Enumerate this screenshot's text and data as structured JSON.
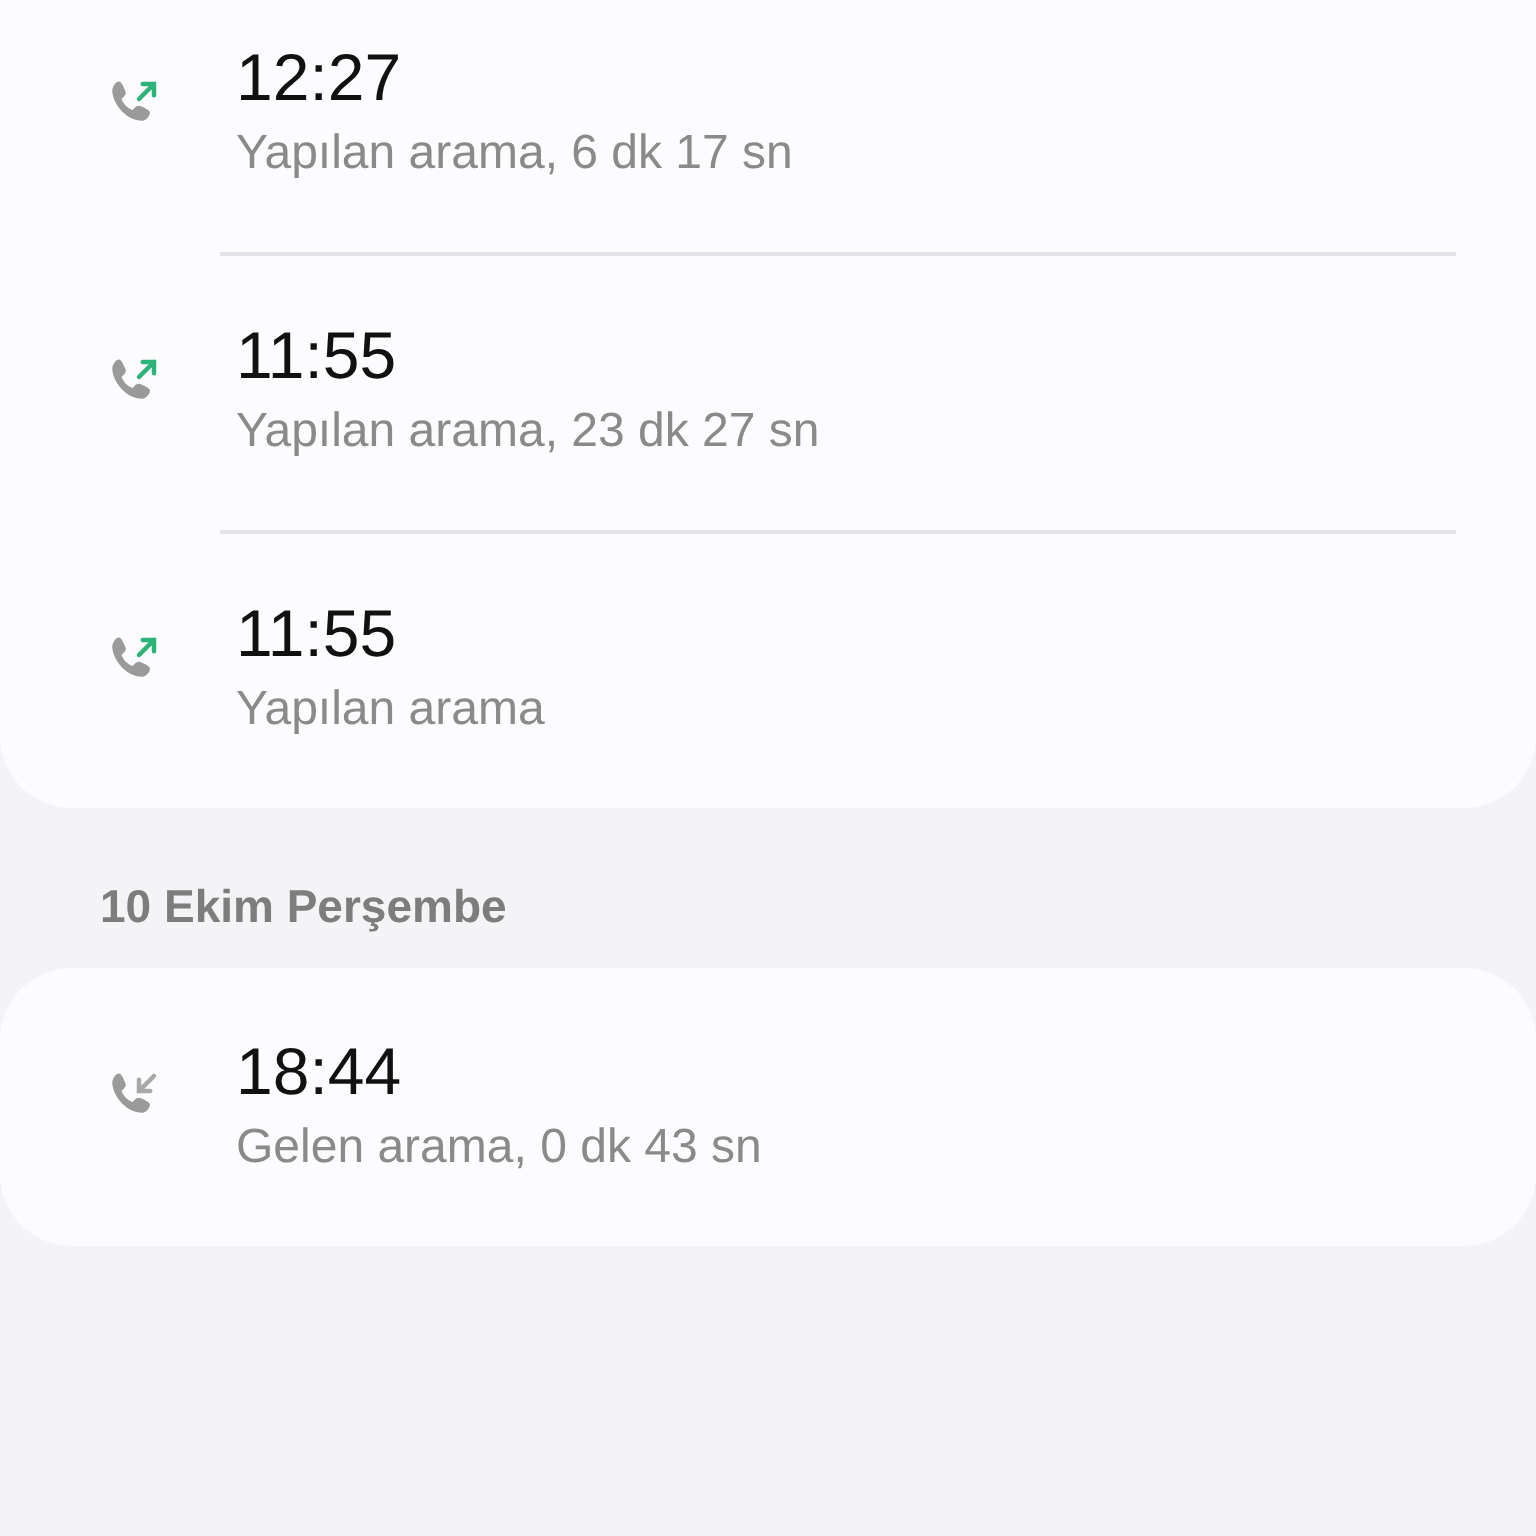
{
  "groups": [
    {
      "calls": [
        {
          "kind": "outgoing",
          "time": "12:27",
          "detail": "Yapılan arama, 6 dk 17 sn"
        },
        {
          "kind": "outgoing",
          "time": "11:55",
          "detail": "Yapılan arama, 23 dk 27 sn"
        },
        {
          "kind": "outgoing",
          "time": "11:55",
          "detail": "Yapılan arama"
        }
      ]
    },
    {
      "header": "10 Ekim Perşembe",
      "calls": [
        {
          "kind": "incoming",
          "time": "18:44",
          "detail": "Gelen arama, 0 dk 43 sn"
        }
      ]
    }
  ]
}
